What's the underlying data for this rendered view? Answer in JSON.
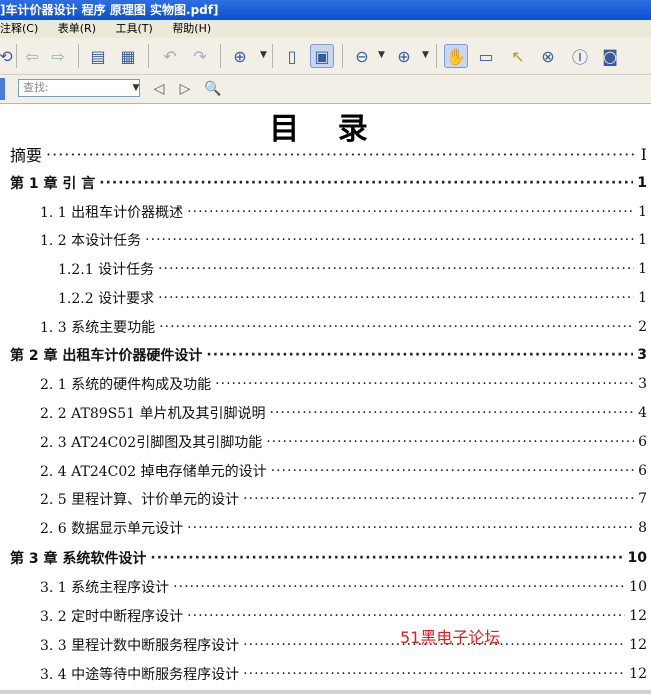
{
  "window": {
    "title": "]车计价器设计 程序 原理图 实物图.pdf]"
  },
  "menu": {
    "items": [
      "注释(C)",
      "表单(R)",
      "工具(T)",
      "帮助(H)"
    ]
  },
  "toolbar": {
    "icons": [
      "refresh-icon",
      "back-icon",
      "forward-icon",
      "save-icon",
      "print-icon",
      "undo-icon",
      "redo-icon",
      "zoom-in-icon",
      "fit-page-icon",
      "actual-size-icon",
      "zoom-out-circle-icon",
      "zoom-in-circle-icon",
      "hand-icon",
      "text-select-icon",
      "pointer-icon",
      "binoculars-icon",
      "text-tool-icon",
      "snapshot-icon"
    ]
  },
  "search": {
    "placeholder": "查找:"
  },
  "document": {
    "title": "目 录",
    "entries": [
      {
        "label": "摘要",
        "page": "I",
        "level": 0
      },
      {
        "label": "第 1 章  引 言",
        "page": "1",
        "level": "ch"
      },
      {
        "label": "1. 1   出租车计价器概述",
        "page": "1",
        "level": 1
      },
      {
        "label": "1. 2   本设计任务",
        "page": "1",
        "level": 1
      },
      {
        "label": "1.2.1    设计任务",
        "page": "1",
        "level": 2
      },
      {
        "label": "1.2.2    设计要求",
        "page": "1",
        "level": 2
      },
      {
        "label": "1. 3   系统主要功能",
        "page": "2",
        "level": 1
      },
      {
        "label": "第 2 章  出租车计价器硬件设计",
        "page": "3",
        "level": "ch"
      },
      {
        "label": "2. 1  系统的硬件构成及功能",
        "page": "3",
        "level": 1
      },
      {
        "label": "2. 2   AT89S51 单片机及其引脚说明",
        "page": "4",
        "level": 1
      },
      {
        "label": "2. 3   AT24C02引脚图及其引脚功能",
        "page": "6",
        "level": 1
      },
      {
        "label": "2. 4   AT24C02  掉电存储单元的设计",
        "page": "6",
        "level": 1
      },
      {
        "label": "2. 5   里程计算、计价单元的设计",
        "page": "7",
        "level": 1
      },
      {
        "label": "2. 6   数据显示单元设计",
        "page": "8",
        "level": 1
      },
      {
        "label": "第 3 章  系统软件设计",
        "page": "10",
        "level": "ch"
      },
      {
        "label": "3. 1   系统主程序设计",
        "page": "10",
        "level": 1
      },
      {
        "label": "3. 2   定时中断程序设计",
        "page": "12",
        "level": 1
      },
      {
        "label": "3. 3   里程计数中断服务程序设计",
        "page": "12",
        "level": 1
      },
      {
        "label": "3. 4   中途等待中断服务程序设计",
        "page": "12",
        "level": 1
      }
    ],
    "watermark": "51黑电子论坛"
  }
}
